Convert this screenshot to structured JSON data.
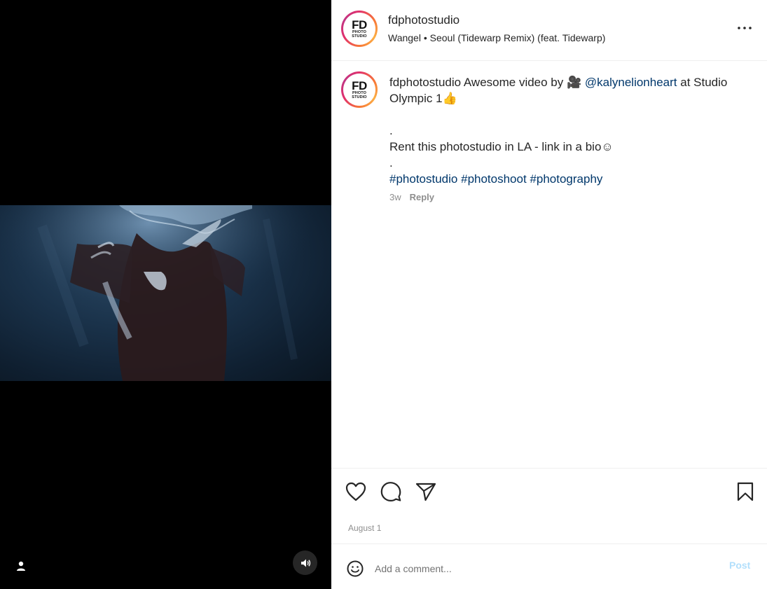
{
  "post": {
    "username": "fdphotostudio",
    "avatar_text": {
      "main": "FD",
      "sub1": "PHOTO",
      "sub2": "STUDIO"
    },
    "audio": "Wangel • Seoul (Tidewarp Remix) (feat. Tidewarp)"
  },
  "caption": {
    "username": "fdphotostudio",
    "text1": "Awesome video by 🎥",
    "mention": "@kalynelionheart",
    "text2": "at Studio Olympic 1👍",
    "dot1": ".",
    "line2": "Rent this photostudio in LA - link in a bio☺",
    "dot2": ".",
    "hashtags": [
      "#photostudio",
      "#photoshoot",
      "#photography"
    ],
    "age": "3w",
    "reply_label": "Reply"
  },
  "actions": {
    "like_icon": "heart-icon",
    "comment_icon": "comment-icon",
    "share_icon": "share-icon",
    "save_icon": "bookmark-icon",
    "date": "August 1"
  },
  "comment_bar": {
    "placeholder": "Add a comment...",
    "post_label": "Post",
    "post_color": "#b2dffc"
  },
  "colors": {
    "link": "#00376b",
    "muted": "#8e8e8e",
    "border": "#efefef"
  }
}
